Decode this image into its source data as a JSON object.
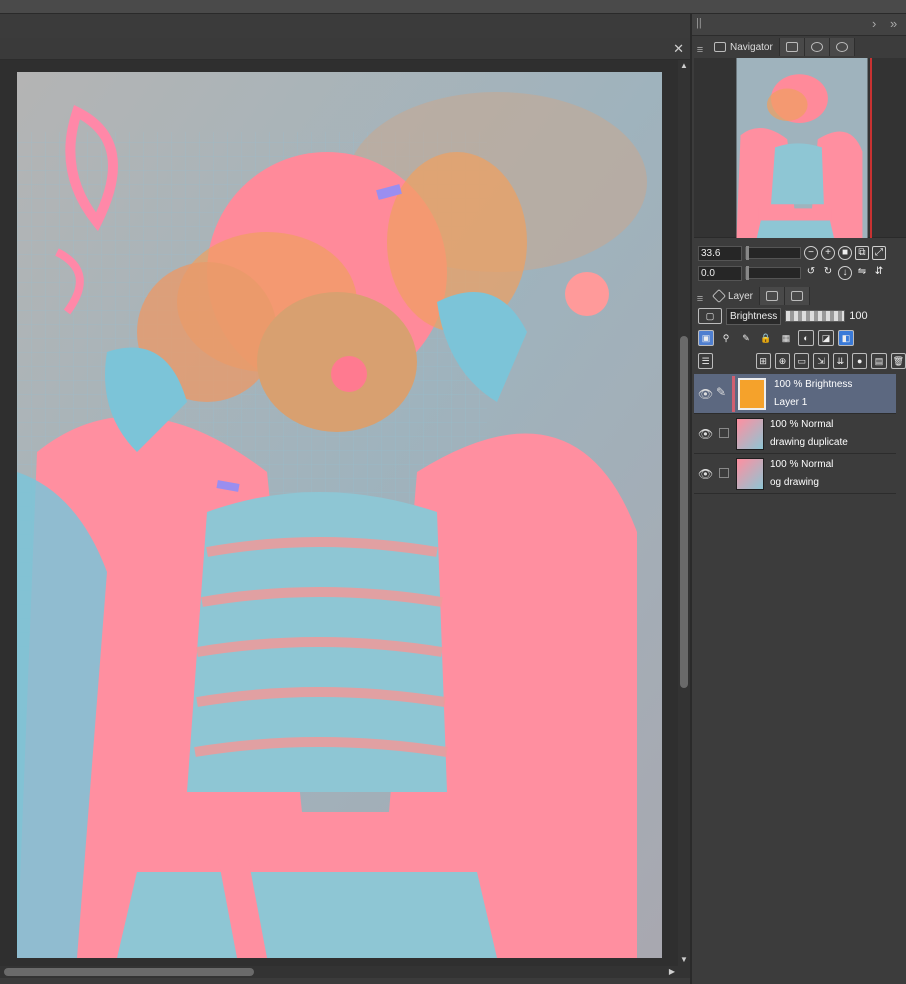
{
  "panel": {
    "tabs": {
      "navigator": "Navigator",
      "layer": "Layer"
    },
    "navigator": {
      "zoom": "33.6",
      "rotation": "0.0"
    },
    "layer_panel": {
      "blend_mode": "Brightness",
      "opacity": "100",
      "layers": [
        {
          "mode": "100 % Brightness",
          "name": "Layer 1",
          "selected": true
        },
        {
          "mode": "100 % Normal",
          "name": "drawing duplicate",
          "selected": false
        },
        {
          "mode": "100 % Normal",
          "name": "og drawing",
          "selected": false
        }
      ]
    }
  },
  "colors": {
    "selected_layer": "#5c6880",
    "brightness_layer_fill": "#f5a22b",
    "art_pink": "#ff8aa0",
    "art_blue": "#7cc4d8",
    "art_orange": "#f0a060"
  },
  "icons": [
    "eye-icon",
    "pen-icon",
    "zoom-out-icon",
    "zoom-in-icon",
    "rotate-left-icon",
    "rotate-right-icon",
    "trash-icon",
    "close-icon"
  ]
}
